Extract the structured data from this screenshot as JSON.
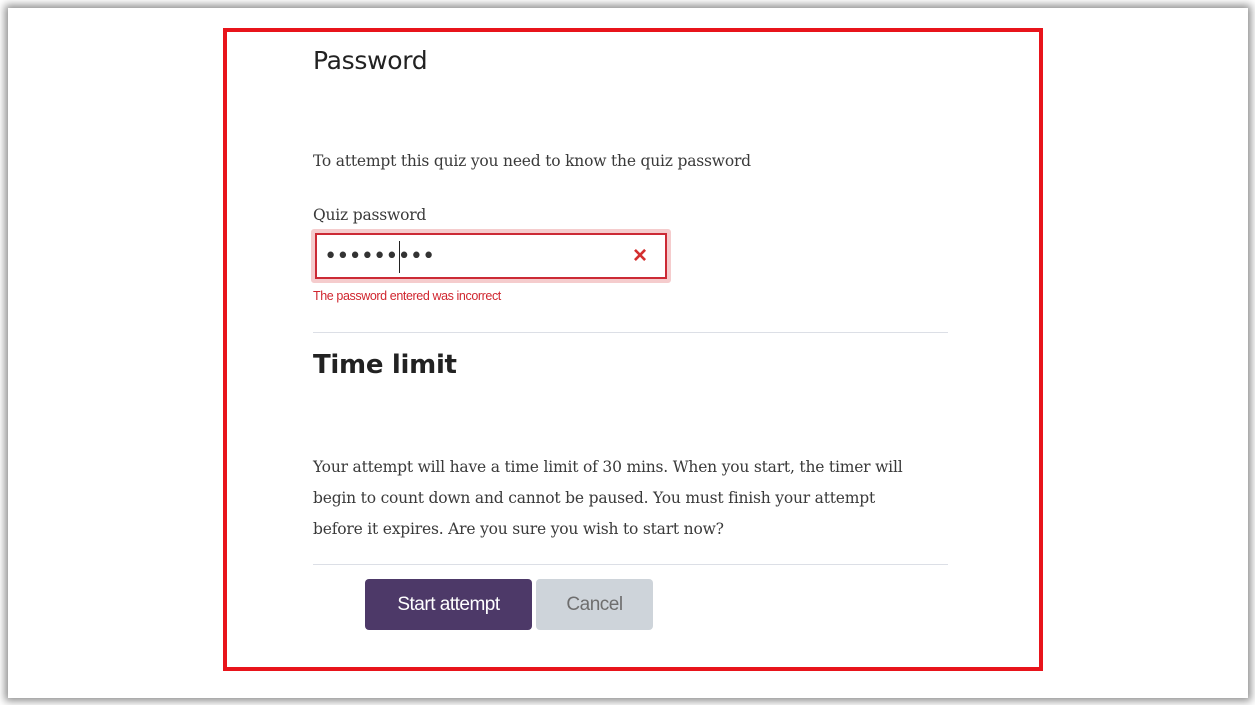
{
  "password_section": {
    "heading": "Password",
    "intro": "To attempt this quiz you need to know the quiz password",
    "field_label": "Quiz password",
    "masked_value": "•••••••••",
    "error": "The password entered was incorrect",
    "clear_icon": "×"
  },
  "time_limit_section": {
    "heading": "Time limit",
    "lines": [
      "Your attempt will have a time limit of 30 mins. When you start, the timer will",
      "begin to count down and cannot be paused. You must finish your attempt",
      "before it expires. Are you sure you wish to start now?"
    ]
  },
  "actions": {
    "start_label": "Start attempt",
    "cancel_label": "Cancel"
  },
  "colors": {
    "highlight_border": "#e8141b",
    "primary_button": "#4d3968",
    "secondary_button": "#ced4da",
    "error": "#d0262f"
  },
  "icons": {
    "clear": "close-x-icon"
  }
}
